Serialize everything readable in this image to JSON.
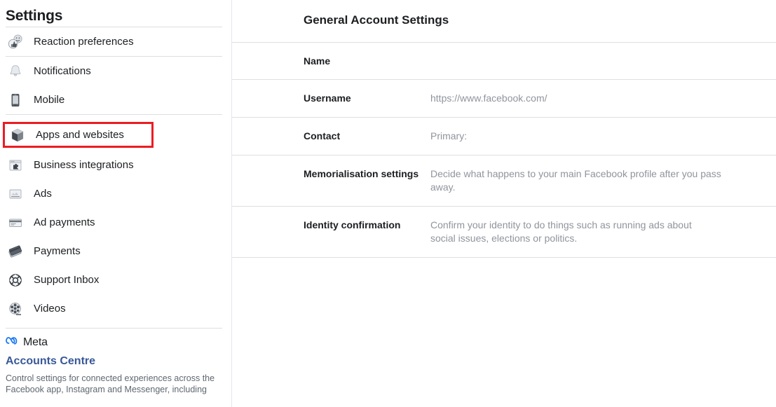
{
  "sidebar": {
    "title": "Settings",
    "items": [
      {
        "label": "Reaction preferences",
        "icon": "reaction-icon",
        "highlighted": false
      },
      {
        "label": "Notifications",
        "icon": "bell-icon",
        "highlighted": false
      },
      {
        "label": "Mobile",
        "icon": "mobile-phone-icon",
        "highlighted": false
      },
      {
        "label": "Apps and websites",
        "icon": "cube-icon",
        "highlighted": true
      },
      {
        "label": "Business integrations",
        "icon": "puzzle-browser-icon",
        "highlighted": false
      },
      {
        "label": "Ads",
        "icon": "ads-card-icon",
        "highlighted": false
      },
      {
        "label": "Ad payments",
        "icon": "credit-card-icon",
        "highlighted": false
      },
      {
        "label": "Payments",
        "icon": "payment-cards-icon",
        "highlighted": false
      },
      {
        "label": "Support Inbox",
        "icon": "life-ring-icon",
        "highlighted": false
      },
      {
        "label": "Videos",
        "icon": "film-reel-icon",
        "highlighted": false
      }
    ],
    "footer": {
      "brand": "Meta",
      "brand_icon": "meta-infinity-logo",
      "link": "Accounts Centre",
      "description": "Control settings for connected experiences across the Facebook app, Instagram and Messenger, including"
    }
  },
  "content": {
    "title": "General Account Settings",
    "rows": [
      {
        "label": "Name",
        "value": ""
      },
      {
        "label": "Username",
        "value": "https://www.facebook.com/"
      },
      {
        "label": "Contact",
        "value": "Primary:"
      },
      {
        "label": "Memorialisation settings",
        "value": "Decide what happens to your main Facebook profile after you pass away."
      },
      {
        "label": "Identity confirmation",
        "value": "Confirm your identity to do things such as running ads about social issues, elections or politics."
      }
    ]
  },
  "colors": {
    "highlight_border": "#ec1c24",
    "link_blue": "#385898",
    "text_primary": "#1c1e21",
    "text_muted": "#90949c",
    "divider": "#dddfe2",
    "meta_blue": "#1877f2"
  }
}
